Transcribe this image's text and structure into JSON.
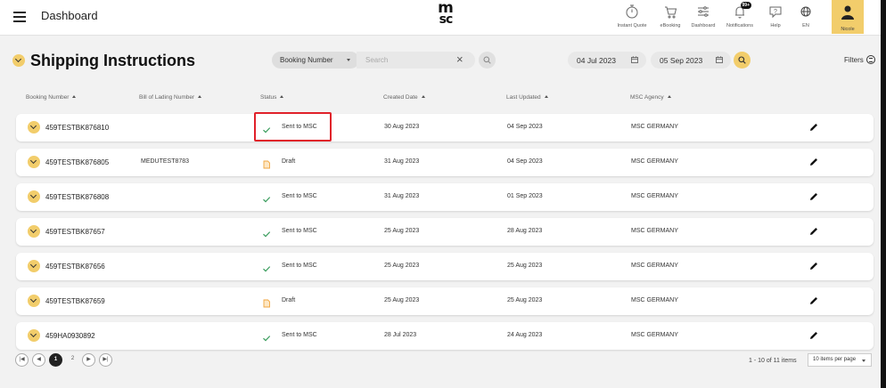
{
  "header": {
    "title": "Dashboard",
    "logo_line1": "m",
    "logo_line2": "sc",
    "nav": [
      {
        "label": "Instant Quote",
        "icon": "stopwatch-icon"
      },
      {
        "label": "eBooking",
        "icon": "cart-icon"
      },
      {
        "label": "Dashboard",
        "icon": "sliders-icon"
      },
      {
        "label": "Notifications",
        "icon": "bell-icon",
        "badge": "99+"
      },
      {
        "label": "Help",
        "icon": "help-chat-icon"
      },
      {
        "label": "EN",
        "icon": "globe-icon"
      }
    ],
    "user": {
      "label": "Nicole",
      "icon": "user-icon"
    }
  },
  "page": {
    "title": "Shipping Instructions",
    "filter_field": "Booking Number",
    "search_placeholder": "Search",
    "date_from": "04 Jul 2023",
    "date_to": "05 Sep 2023",
    "filters_label": "Filters"
  },
  "columns": [
    "Booking Number",
    "Bill of Lading Number",
    "Status",
    "Created Date",
    "Last Updated",
    "MSC Agency"
  ],
  "rows": [
    {
      "booking": "459TESTBK876810",
      "bol": "",
      "status": "Sent to MSC",
      "status_icon": "check-icon",
      "created": "30 Aug 2023",
      "updated": "04 Sep 2023",
      "agency": "MSC GERMANY"
    },
    {
      "booking": "459TESTBK876805",
      "bol": "MEDUTEST8783",
      "status": "Draft",
      "status_icon": "draft-icon",
      "created": "31 Aug 2023",
      "updated": "04 Sep 2023",
      "agency": "MSC GERMANY"
    },
    {
      "booking": "459TESTBK876808",
      "bol": "",
      "status": "Sent to MSC",
      "status_icon": "check-icon",
      "created": "31 Aug 2023",
      "updated": "01 Sep 2023",
      "agency": "MSC GERMANY"
    },
    {
      "booking": "459TESTBK87657",
      "bol": "",
      "status": "Sent to MSC",
      "status_icon": "check-icon",
      "created": "25 Aug 2023",
      "updated": "28 Aug 2023",
      "agency": "MSC GERMANY"
    },
    {
      "booking": "459TESTBK87656",
      "bol": "",
      "status": "Sent to MSC",
      "status_icon": "check-icon",
      "created": "25 Aug 2023",
      "updated": "25 Aug 2023",
      "agency": "MSC GERMANY"
    },
    {
      "booking": "459TESTBK87659",
      "bol": "",
      "status": "Draft",
      "status_icon": "draft-icon",
      "created": "25 Aug 2023",
      "updated": "25 Aug 2023",
      "agency": "MSC GERMANY"
    },
    {
      "booking": "459HA0930892",
      "bol": "",
      "status": "Sent to MSC",
      "status_icon": "check-icon",
      "created": "28 Jul 2023",
      "updated": "24 Aug 2023",
      "agency": "MSC GERMANY"
    }
  ],
  "pagination": {
    "pages": [
      "1",
      "2"
    ],
    "current": "1",
    "info": "1 - 10 of 11 items",
    "per_page": "10 items per page"
  },
  "colors": {
    "accent": "#f2cd6b",
    "highlight": "#e0212a",
    "check": "#3a9d5d",
    "draft": "#f0a640"
  }
}
